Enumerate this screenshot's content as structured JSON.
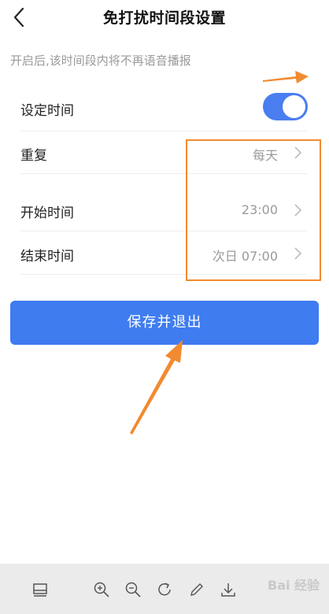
{
  "header": {
    "title": "免打扰时间段设置"
  },
  "subtitle": "开启后,该时间段内将不再语音播报",
  "rows": {
    "set_time": {
      "label": "设定时间",
      "enabled": true
    },
    "repeat": {
      "label": "重复",
      "value": "每天"
    },
    "start": {
      "label": "开始时间",
      "value": "23:00"
    },
    "end": {
      "label": "结束时间",
      "value": "次日 07:00"
    }
  },
  "save_button": "保存并退出",
  "colors": {
    "accent": "#3e7cf0",
    "toggle_on": "#4a7df0",
    "annotation": "#f28a30"
  },
  "toolbar": {
    "icons": [
      "layout-icon",
      "zoom-in-icon",
      "zoom-out-icon",
      "rotate-icon",
      "pen-icon",
      "download-icon"
    ]
  },
  "watermark": "Bai 经验"
}
